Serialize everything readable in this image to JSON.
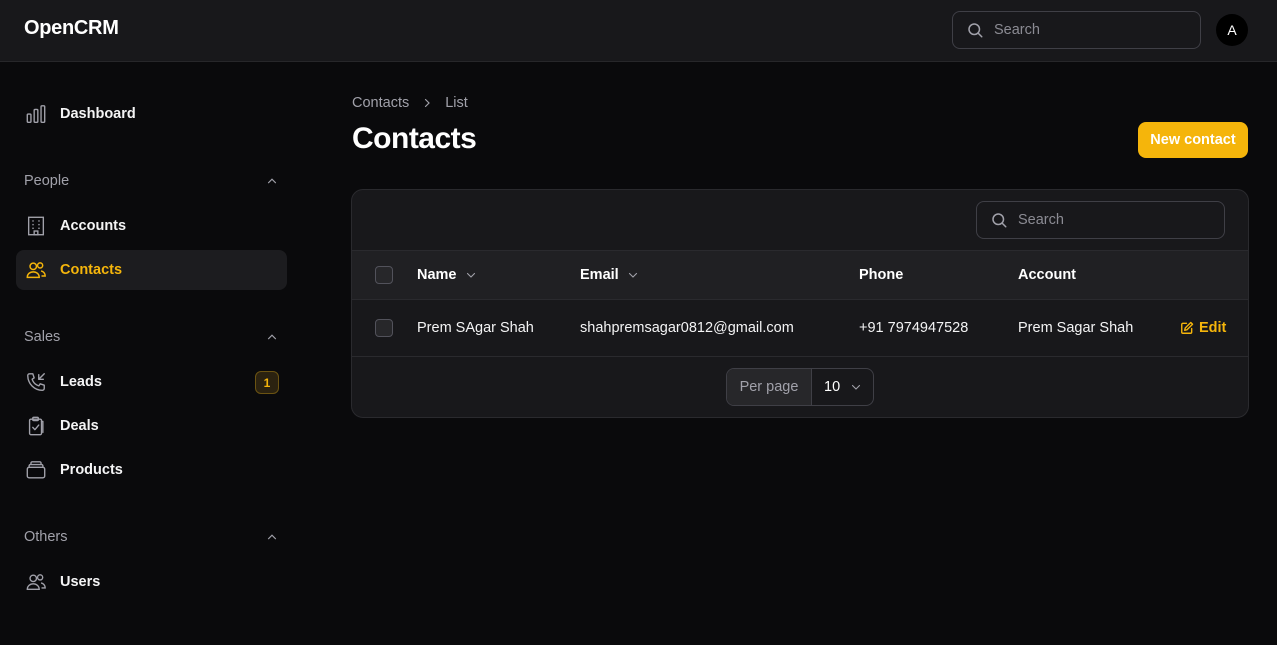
{
  "app": {
    "brand": "OpenCRM"
  },
  "topbar": {
    "search_placeholder": "Search",
    "avatar_initial": "A"
  },
  "sidebar": {
    "dashboard": "Dashboard",
    "groups": {
      "people": {
        "label": "People",
        "items": {
          "accounts": "Accounts",
          "contacts": "Contacts"
        }
      },
      "sales": {
        "label": "Sales",
        "items": {
          "leads": "Leads",
          "leads_badge": "1",
          "deals": "Deals",
          "products": "Products"
        }
      },
      "others": {
        "label": "Others",
        "items": {
          "users": "Users"
        }
      }
    },
    "active_item": "Contacts"
  },
  "breadcrumb": {
    "root": "Contacts",
    "current": "List"
  },
  "page": {
    "title": "Contacts",
    "new_button": "New contact"
  },
  "table": {
    "search_placeholder": "Search",
    "columns": {
      "name": "Name",
      "email": "Email",
      "phone": "Phone",
      "account": "Account"
    },
    "rows": [
      {
        "name": "Prem SAgar Shah",
        "email": "shahpremsagar0812@gmail.com",
        "phone": "+91 7974947528",
        "account": "Prem Sagar Shah",
        "action": "Edit"
      }
    ],
    "pagination": {
      "per_page_label": "Per page",
      "per_page_value": "10"
    }
  },
  "colors": {
    "accent": "#f5b50b",
    "background": "#0a0a0c",
    "surface": "#18181b"
  },
  "icons": [
    "search-icon",
    "bar-chart-icon",
    "building-icon",
    "users-icon",
    "phone-icon",
    "clipboard-check-icon",
    "box-icon",
    "chevron-up-icon",
    "chevron-down-icon",
    "chevron-right-icon",
    "edit-icon"
  ]
}
